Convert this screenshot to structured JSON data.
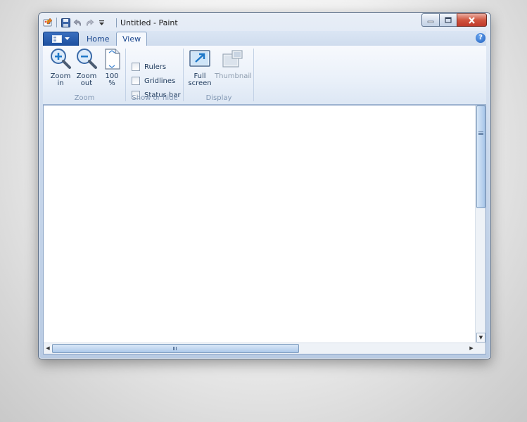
{
  "window": {
    "title": "Untitled - Paint"
  },
  "ribbon": {
    "tabs": [
      {
        "label": "Home"
      },
      {
        "label": "View"
      }
    ],
    "help_label": "?",
    "groups": {
      "zoom": {
        "label": "Zoom",
        "zoom_in": [
          "Zoom",
          "in"
        ],
        "zoom_out": [
          "Zoom",
          "out"
        ],
        "zoom_100": [
          "100",
          "%"
        ]
      },
      "show_hide": {
        "label": "Show or hide",
        "rulers": "Rulers",
        "gridlines": "Gridlines",
        "status_bar": "Status bar"
      },
      "display": {
        "label": "Display",
        "full_screen": [
          "Full",
          "screen"
        ],
        "thumbnail": "Thumbnail"
      }
    }
  },
  "icons": {
    "app": "paint-app-icon",
    "save": "save-icon",
    "undo": "undo-icon",
    "redo": "redo-icon",
    "customize": "qat-dropdown-icon"
  },
  "colors": {
    "accent": "#1d4f9f",
    "close_button": "#c0392b",
    "ribbon_bg": "#e9f0f9"
  }
}
